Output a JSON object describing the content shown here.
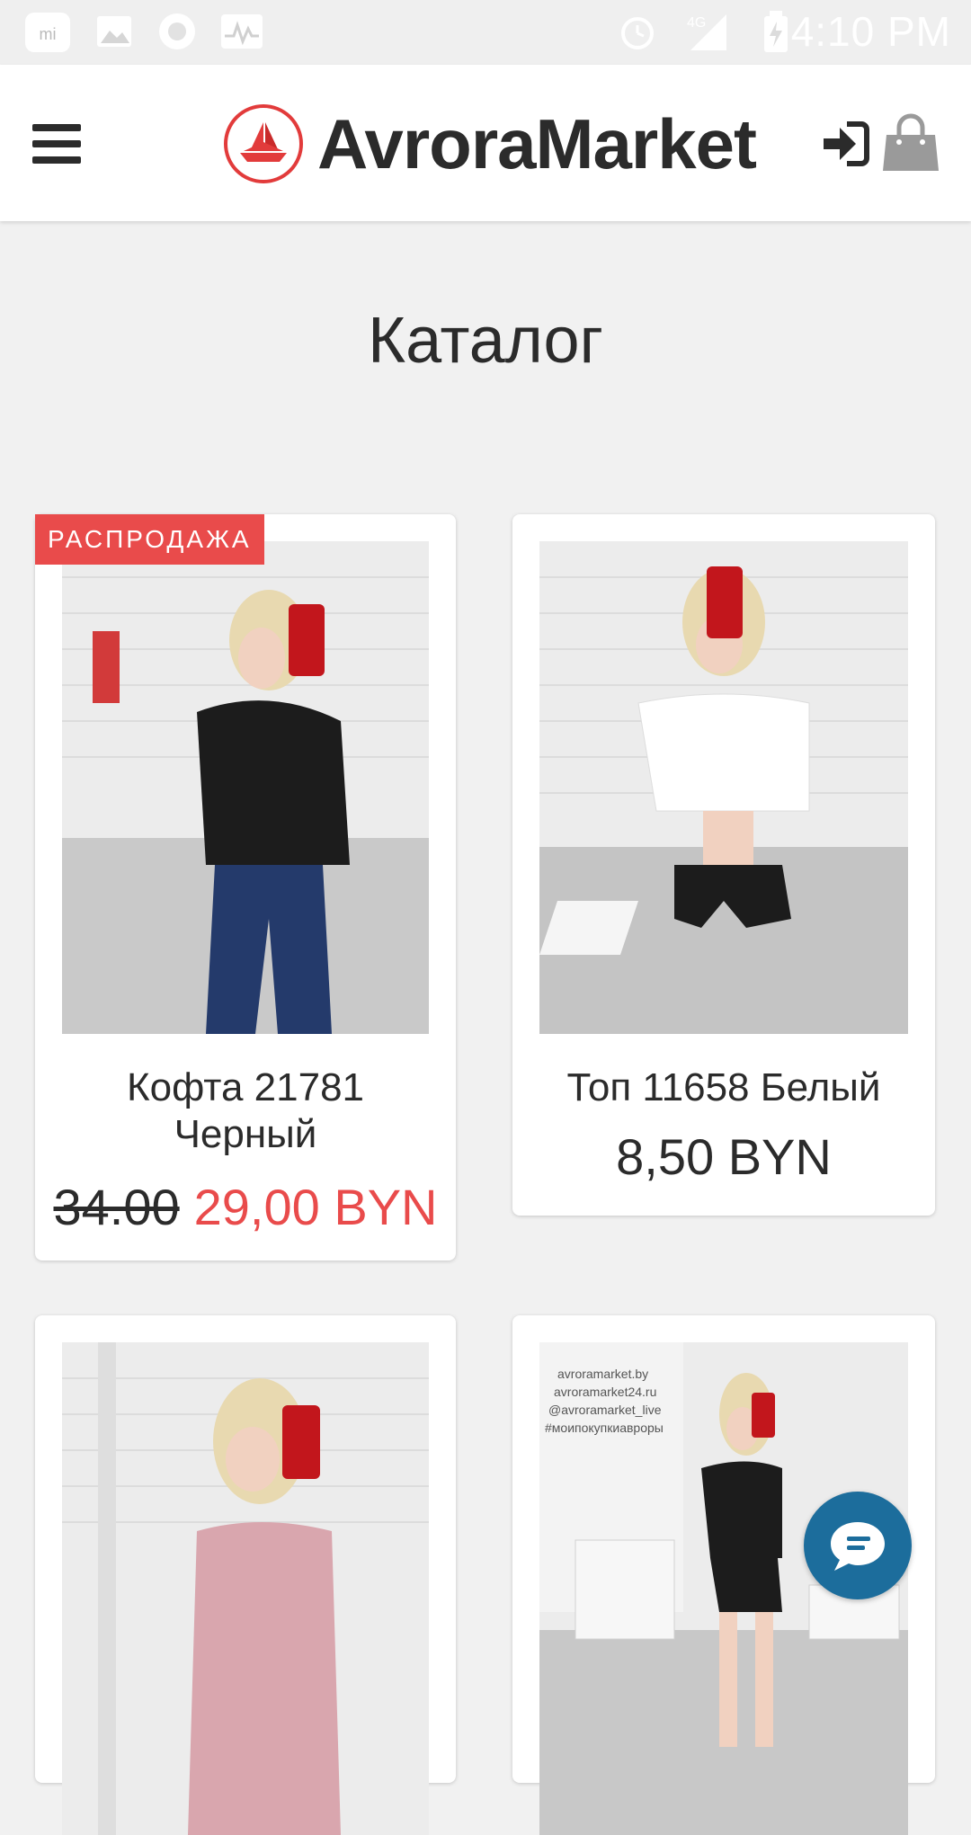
{
  "status_bar": {
    "time": "4:10 PM",
    "network": "4G",
    "icons": [
      "mi-icon",
      "image-icon",
      "circle-icon",
      "activity-icon",
      "alarm-icon",
      "signal-icon",
      "battery-icon"
    ]
  },
  "header": {
    "brand": "AvroraMarket",
    "menu_icon": "hamburger-icon",
    "login_icon": "sign-in-icon",
    "cart_icon": "shopping-bag-icon"
  },
  "page": {
    "title": "Каталог"
  },
  "products": [
    {
      "badge": "РАСПРОДАЖА",
      "name_line1": "Кофта 21781",
      "name_line2": "Черный",
      "old_price": "34.00",
      "price": "29,00 BYN"
    },
    {
      "name_line1": "Топ 11658 Белый",
      "price": "8,50 BYN"
    },
    {},
    {}
  ],
  "chat": {
    "icon": "chat-bubble-icon"
  },
  "colors": {
    "accent": "#e94b4b",
    "chat": "#1c6d9c",
    "text": "#2b2b2b",
    "background": "#f1f1f1"
  }
}
